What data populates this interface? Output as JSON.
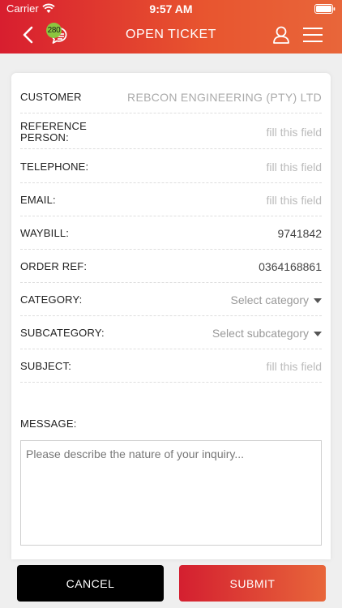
{
  "status_bar": {
    "carrier": "Carrier",
    "time": "9:57 AM"
  },
  "nav": {
    "title": "OPEN TICKET",
    "badge_count": "280",
    "icons": [
      "back-icon",
      "chat-icon",
      "profile-icon",
      "menu-icon"
    ]
  },
  "form": {
    "fields": [
      {
        "label": "CUSTOMER",
        "value": "REBCON ENGINEERING (PTY) LTD",
        "type": "readonly"
      },
      {
        "label": "REFERENCE PERSON:",
        "value": "",
        "placeholder": "fill this field",
        "type": "text"
      },
      {
        "label": "TELEPHONE:",
        "value": "",
        "placeholder": "fill this field",
        "type": "text"
      },
      {
        "label": "EMAIL:",
        "value": "",
        "placeholder": "fill this field",
        "type": "text"
      },
      {
        "label": "WAYBILL:",
        "value": "9741842",
        "type": "text"
      },
      {
        "label": "ORDER REF:",
        "value": "0364168861",
        "type": "text"
      },
      {
        "label": "CATEGORY:",
        "value": "Select category",
        "type": "select"
      },
      {
        "label": "SUBCATEGORY:",
        "value": "Select subcategory",
        "type": "select"
      },
      {
        "label": "SUBJECT:",
        "value": "",
        "placeholder": "fill this field",
        "type": "text"
      }
    ],
    "message_label": "MESSAGE:",
    "message_placeholder": "Please describe the nature of your inquiry..."
  },
  "buttons": {
    "cancel": "CANCEL",
    "submit": "SUBMIT"
  },
  "colors": {
    "brand_red": "#d81e2f",
    "brand_orange": "#e8663a",
    "badge_green": "#8cc63f"
  }
}
